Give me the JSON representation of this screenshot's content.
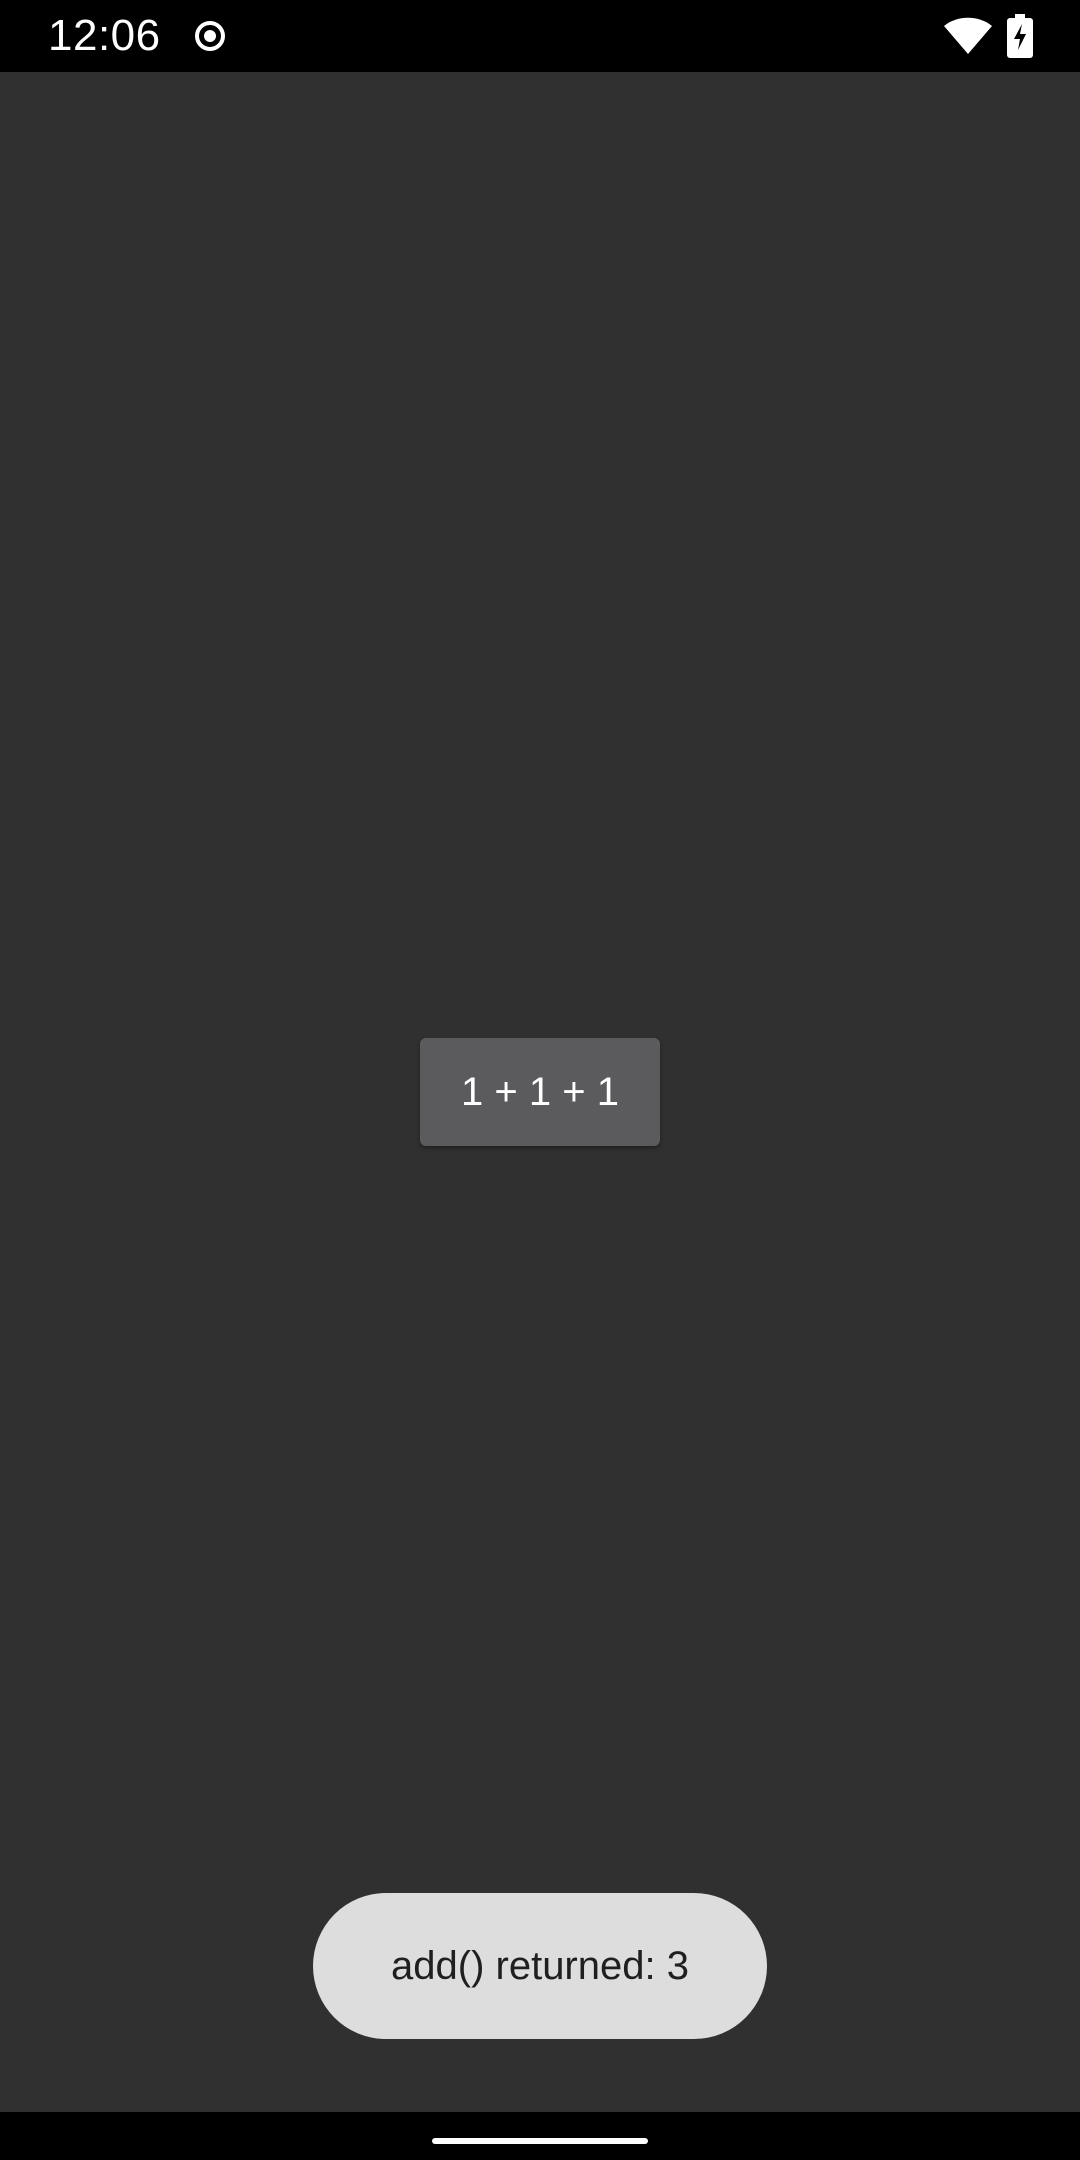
{
  "status_bar": {
    "time": "12:06",
    "icons": [
      "record-icon",
      "wifi-icon",
      "battery-charging-icon"
    ]
  },
  "main": {
    "button_label": "1 + 1 + 1"
  },
  "toast": {
    "message": "add() returned: 3"
  },
  "colors": {
    "background": "#303030",
    "button": "#5b5b5d",
    "toast": "#dddddd",
    "bars": "#000000"
  }
}
